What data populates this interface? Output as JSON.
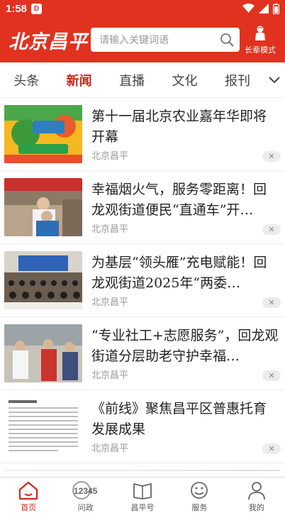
{
  "status_bar": {
    "time": "1:58",
    "app_badge": "D"
  },
  "header": {
    "logo": "北京昌平",
    "search_placeholder": "请输入关键词语",
    "elder_mode_label": "长辈模式"
  },
  "tabs": [
    {
      "label": "头条",
      "active": false
    },
    {
      "label": "新闻",
      "active": true
    },
    {
      "label": "直播",
      "active": false
    },
    {
      "label": "文化",
      "active": false
    },
    {
      "label": "报刊",
      "active": false
    }
  ],
  "news": [
    {
      "title": "第十一届北京农业嘉年华即将开幕",
      "source": "北京昌平",
      "thumb_icon": "agri-carnival-photo"
    },
    {
      "title": "幸福烟火气，服务零距离！回龙观街道便民“直通车”开…",
      "source": "北京昌平",
      "thumb_icon": "haircut-service-photo"
    },
    {
      "title": "为基层“领头雁”充电赋能！回龙观街道2025年“两委…",
      "source": "北京昌平",
      "thumb_icon": "meeting-hall-photo"
    },
    {
      "title": "“专业社工+志愿服务”，回龙观街道分层助老守护幸福…",
      "source": "北京昌平",
      "thumb_icon": "elderly-care-photo"
    },
    {
      "title": "《前线》聚焦昌平区普惠托育发展成果",
      "source": "北京昌平",
      "thumb_icon": "document-page-photo"
    }
  ],
  "bottom_nav": [
    {
      "label": "首页",
      "icon": "home-icon",
      "active": true
    },
    {
      "label": "问政",
      "icon": "hotline-12345-icon",
      "active": false,
      "icon_text": "12345"
    },
    {
      "label": "昌平号",
      "icon": "book-icon",
      "active": false
    },
    {
      "label": "服务",
      "icon": "smile-icon",
      "active": false
    },
    {
      "label": "我的",
      "icon": "user-icon",
      "active": false
    }
  ],
  "colors": {
    "brand_red": "#e0321f",
    "active_tab": "#d3261b"
  }
}
